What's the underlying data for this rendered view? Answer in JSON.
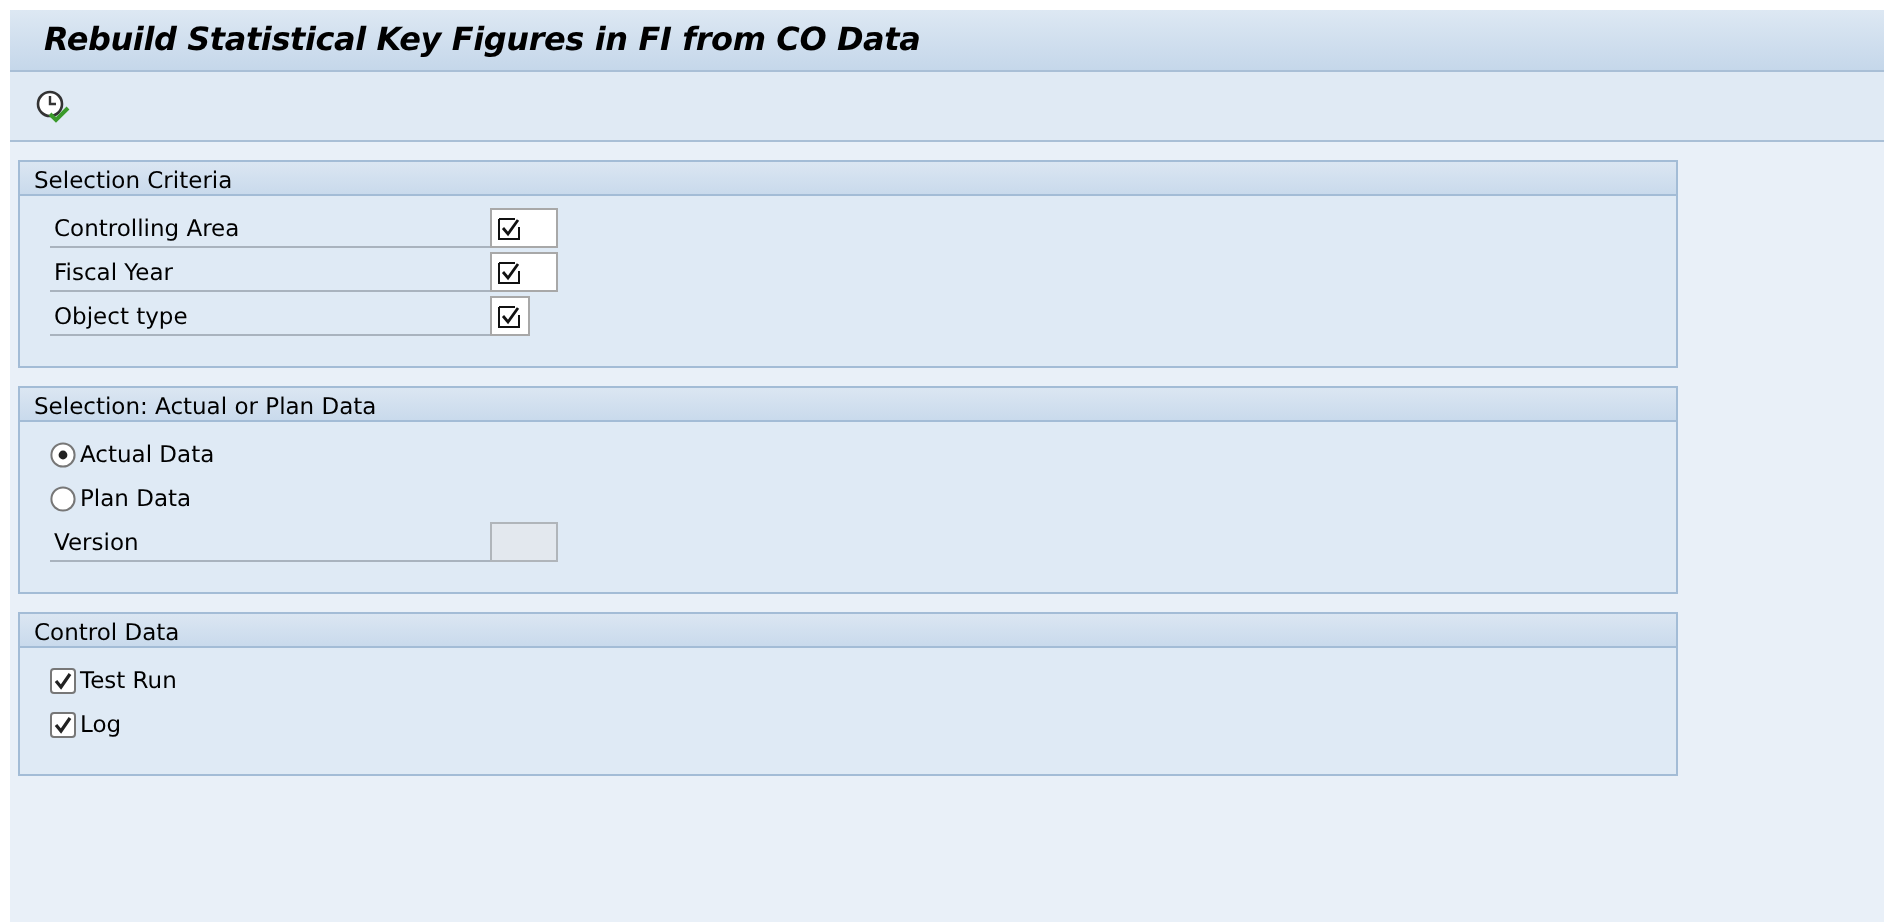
{
  "window": {
    "title": "Rebuild Statistical Key Figures in FI from CO Data"
  },
  "toolbar": {
    "buttons": [
      {
        "kind": "execute"
      }
    ]
  },
  "groups": [
    {
      "title": "Selection Criteria",
      "rows": [
        {
          "kind": "field",
          "label": "Controlling Area",
          "required": true,
          "disabled": false
        },
        {
          "kind": "field",
          "label": "Fiscal Year",
          "required": true,
          "disabled": false
        },
        {
          "kind": "short-field",
          "label": "Object type",
          "required": true,
          "disabled": false
        }
      ]
    },
    {
      "title": "Selection: Actual or Plan Data",
      "rows": [
        {
          "kind": "radio",
          "label": "Actual Data",
          "selected": true
        },
        {
          "kind": "radio",
          "label": "Plan Data",
          "selected": false
        },
        {
          "kind": "field",
          "label": "Version",
          "required": false,
          "disabled": true
        }
      ]
    },
    {
      "title": "Control Data",
      "rows": [
        {
          "kind": "checkbox",
          "label": "Test Run",
          "checked": true
        },
        {
          "kind": "checkbox",
          "label": "Log",
          "checked": true
        }
      ]
    }
  ]
}
